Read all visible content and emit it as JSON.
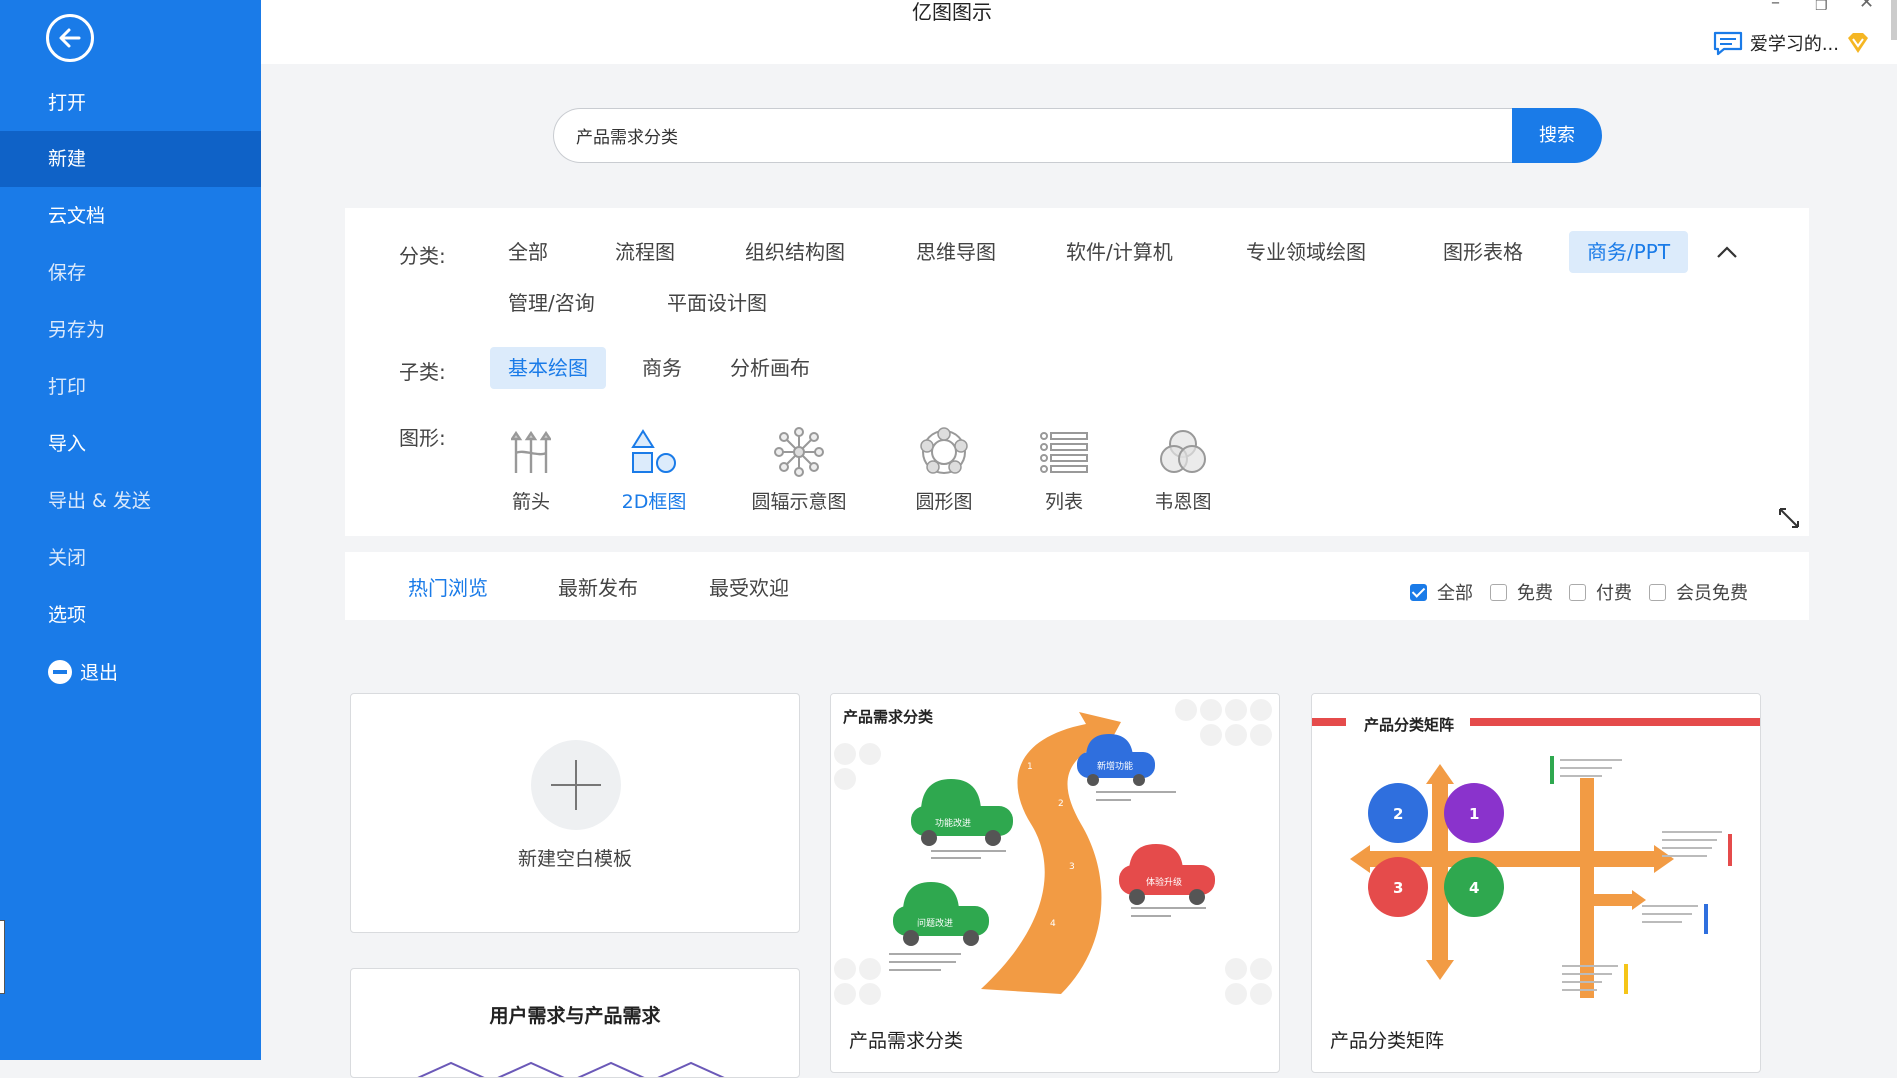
{
  "app": {
    "title": "亿图图示",
    "user": "爱学习的..."
  },
  "sidebar": {
    "items": [
      {
        "id": "open",
        "label": "打开"
      },
      {
        "id": "new",
        "label": "新建",
        "active": true
      },
      {
        "id": "cloud",
        "label": "云文档"
      },
      {
        "id": "save",
        "label": "保存"
      },
      {
        "id": "saveas",
        "label": "另存为"
      },
      {
        "id": "print",
        "label": "打印"
      },
      {
        "id": "import",
        "label": "导入"
      },
      {
        "id": "export",
        "label": "导出 & 发送"
      },
      {
        "id": "close",
        "label": "关闭"
      },
      {
        "id": "options",
        "label": "选项"
      },
      {
        "id": "exit",
        "label": "退出"
      }
    ]
  },
  "search": {
    "value": "产品需求分类",
    "button": "搜索"
  },
  "filters": {
    "category_label": "分类:",
    "categories": [
      "全部",
      "流程图",
      "组织结构图",
      "思维导图",
      "软件/计算机",
      "专业领域绘图",
      "图形表格",
      "商务/PPT",
      "管理/咨询",
      "平面设计图"
    ],
    "category_active": "商务/PPT",
    "subcategory_label": "子类:",
    "subcategories": [
      "基本绘图",
      "商务",
      "分析画布"
    ],
    "subcategory_active": "基本绘图",
    "shape_label": "图形:",
    "shapes": [
      "箭头",
      "2D框图",
      "圆辐示意图",
      "圆形图",
      "列表",
      "韦恩图"
    ],
    "shape_active": "2D框图"
  },
  "sort": {
    "tabs": [
      "热门浏览",
      "最新发布",
      "最受欢迎"
    ],
    "active": "热门浏览",
    "checks": [
      {
        "label": "全部",
        "checked": true
      },
      {
        "label": "免费",
        "checked": false
      },
      {
        "label": "付费",
        "checked": false
      },
      {
        "label": "会员免费",
        "checked": false
      }
    ]
  },
  "cards": {
    "new_blank": "新建空白模板",
    "tpl1": {
      "name": "产品需求分类",
      "thumb_title": "产品需求分类"
    },
    "tpl2": {
      "name": "产品分类矩阵",
      "thumb_title": "产品分类矩阵"
    },
    "card2_title": "用户需求与产品需求"
  },
  "colors": {
    "accent": "#1a7be8",
    "sidebar_active": "#0f62c7",
    "orange": "#f29b44",
    "green": "#2fa84f",
    "red": "#e54b4b",
    "blue": "#2f6fde",
    "purple": "#8a33cc"
  }
}
